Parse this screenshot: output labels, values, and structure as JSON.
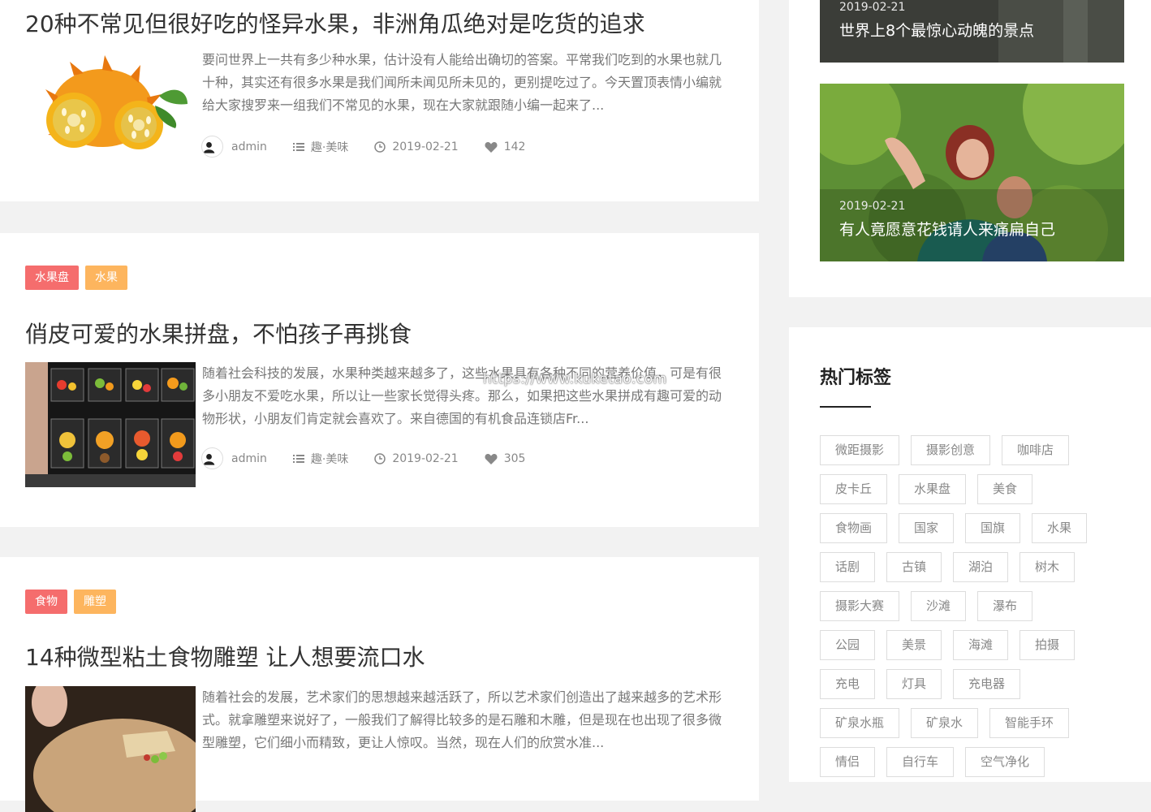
{
  "posts": [
    {
      "title": "20种不常见但很好吃的怪异水果，非洲角瓜绝对是吃货的追求",
      "excerpt": "要问世界上一共有多少种水果，估计没有人能给出确切的答案。平常我们吃到的水果也就几十种，其实还有很多水果是我们闻所未闻见所未见的，更别提吃过了。今天置顶表情小编就给大家搜罗来一组我们不常见的水果，现在大家就跟随小编一起来了...",
      "author": "admin",
      "category": "趣·美味",
      "date": "2019-02-21",
      "likes": "142"
    },
    {
      "tags": [
        "水果盘",
        "水果"
      ],
      "title": "俏皮可爱的水果拼盘，不怕孩子再挑食",
      "excerpt": "随着社会科技的发展，水果种类越来越多了，这些水果具有各种不同的营养价值，可是有很多小朋友不爱吃水果，所以让一些家长觉得头疼。那么，如果把这些水果拼成有趣可爱的动物形状，小朋友们肯定就会喜欢了。来自德国的有机食品连锁店Fr...",
      "author": "admin",
      "category": "趣·美味",
      "date": "2019-02-21",
      "likes": "305"
    },
    {
      "tags": [
        "食物",
        "雕塑"
      ],
      "title": "14种微型粘土食物雕塑 让人想要流口水",
      "excerpt": "随着社会的发展，艺术家们的思想越来越活跃了，所以艺术家们创造出了越来越多的艺术形式。就拿雕塑来说好了，一般我们了解得比较多的是石雕和木雕，但是现在也出现了很多微型雕塑，它们细小而精致，更让人惊叹。当然，现在人们的欣赏水准..."
    }
  ],
  "watermark": "https://www.kuketao.com",
  "sidebar": {
    "features": [
      {
        "date": "2019-02-21",
        "title": "世界上8个最惊心动魄的景点"
      },
      {
        "date": "2019-02-21",
        "title": "有人竟愿意花钱请人来痛扁自己"
      }
    ],
    "hot_tags_title": "热门标签",
    "tag_rows": [
      [
        "微距摄影",
        "摄影创意",
        "咖啡店"
      ],
      [
        "皮卡丘",
        "水果盘",
        "美食"
      ],
      [
        "食物画",
        "国家",
        "国旗",
        "水果"
      ],
      [
        "话剧",
        "古镇",
        "湖泊",
        "树木"
      ],
      [
        "摄影大赛",
        "沙滩",
        "瀑布"
      ],
      [
        "公园",
        "美景",
        "海滩",
        "拍摄"
      ],
      [
        "充电",
        "灯具",
        "充电器"
      ],
      [
        "矿泉水瓶",
        "矿泉水",
        "智能手环"
      ],
      [
        "情侣",
        "自行车",
        "空气净化"
      ]
    ]
  },
  "colors": {
    "tag_red": "#f56d6d",
    "tag_orange": "#fdb55e",
    "page_bg": "#f2f2f2"
  }
}
